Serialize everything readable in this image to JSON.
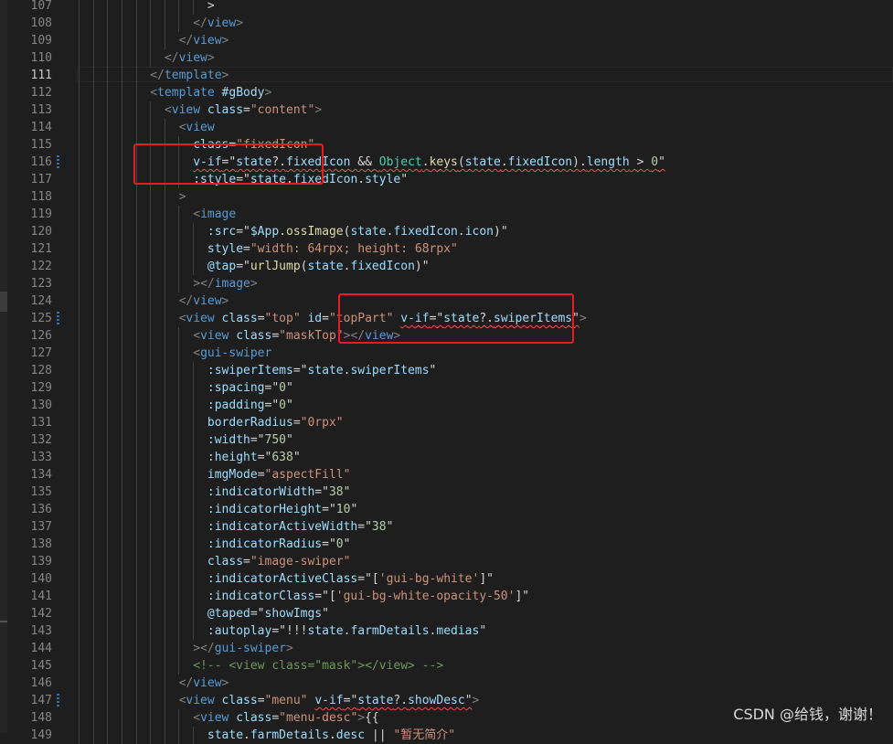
{
  "editor": {
    "active_line": 111,
    "lines": [
      {
        "n": 107,
        "t": [
          [
            "t-tk",
            "                  >"
          ]
        ]
      },
      {
        "n": 108,
        "t": [
          [
            "t-bk",
            "                </"
          ],
          [
            "t-tag",
            "view"
          ],
          [
            "t-bk",
            ">"
          ]
        ]
      },
      {
        "n": 109,
        "t": [
          [
            "t-bk",
            "              </"
          ],
          [
            "t-tag",
            "view"
          ],
          [
            "t-bk",
            ">"
          ]
        ]
      },
      {
        "n": 110,
        "t": [
          [
            "t-bk",
            "            </"
          ],
          [
            "t-tag",
            "view"
          ],
          [
            "t-bk",
            ">"
          ]
        ]
      },
      {
        "n": 111,
        "t": [
          [
            "t-bk",
            "          </"
          ],
          [
            "t-tag",
            "template"
          ],
          [
            "t-bk",
            ">"
          ]
        ]
      },
      {
        "n": 112,
        "t": [
          [
            "t-bk",
            "          <"
          ],
          [
            "t-tag",
            "template"
          ],
          [
            "t-op",
            " "
          ],
          [
            "t-at",
            "#gBody"
          ],
          [
            "t-bk",
            ">"
          ]
        ]
      },
      {
        "n": 113,
        "t": [
          [
            "t-bk",
            "            <"
          ],
          [
            "t-tag",
            "view"
          ],
          [
            "t-op",
            " "
          ],
          [
            "t-at",
            "class"
          ],
          [
            "t-op",
            "="
          ],
          [
            "t-st",
            "\"content\""
          ],
          [
            "t-bk",
            ">"
          ]
        ]
      },
      {
        "n": 114,
        "t": [
          [
            "t-bk",
            "              <"
          ],
          [
            "t-tag",
            "view"
          ]
        ]
      },
      {
        "n": 115,
        "t": [
          [
            "t-op",
            "                "
          ],
          [
            "t-at",
            "class"
          ],
          [
            "t-op",
            "="
          ],
          [
            "t-st",
            "\"fixedIcon\""
          ]
        ]
      },
      {
        "n": 116,
        "git": true,
        "t": [
          [
            "t-op",
            "                "
          ],
          [
            "t-at sq",
            "v-if"
          ],
          [
            "t-op sq",
            "=\""
          ],
          [
            "t-ex sq",
            "state"
          ],
          [
            "t-op sq",
            "?."
          ],
          [
            "t-ex sq",
            "fixedIcon"
          ],
          [
            "t-op sq",
            " && "
          ],
          [
            "t-cl sq",
            "Object"
          ],
          [
            "t-op sq",
            "."
          ],
          [
            "t-fn sq",
            "keys"
          ],
          [
            "t-op sq",
            "("
          ],
          [
            "t-ex sq",
            "state"
          ],
          [
            "t-op sq",
            "."
          ],
          [
            "t-ex sq",
            "fixedIcon"
          ],
          [
            "t-op sq",
            ")."
          ],
          [
            "t-ex sq",
            "length"
          ],
          [
            "t-op sq",
            " > "
          ],
          [
            "t-nm sq",
            "0"
          ],
          [
            "t-op sq",
            "\""
          ]
        ]
      },
      {
        "n": 117,
        "t": [
          [
            "t-op",
            "                "
          ],
          [
            "t-at",
            ":style"
          ],
          [
            "t-op",
            "=\""
          ],
          [
            "t-ex",
            "state"
          ],
          [
            "t-op",
            "."
          ],
          [
            "t-ex",
            "fixedIcon"
          ],
          [
            "t-op",
            "."
          ],
          [
            "t-ex",
            "style"
          ],
          [
            "t-op",
            "\""
          ]
        ]
      },
      {
        "n": 118,
        "t": [
          [
            "t-bk",
            "              >"
          ]
        ]
      },
      {
        "n": 119,
        "t": [
          [
            "t-bk",
            "                <"
          ],
          [
            "t-tag",
            "image"
          ]
        ]
      },
      {
        "n": 120,
        "t": [
          [
            "t-op",
            "                  "
          ],
          [
            "t-at",
            ":src"
          ],
          [
            "t-op",
            "=\""
          ],
          [
            "t-ex",
            "$App"
          ],
          [
            "t-op",
            "."
          ],
          [
            "t-fn",
            "ossImage"
          ],
          [
            "t-op",
            "("
          ],
          [
            "t-ex",
            "state"
          ],
          [
            "t-op",
            "."
          ],
          [
            "t-ex",
            "fixedIcon"
          ],
          [
            "t-op",
            "."
          ],
          [
            "t-ex",
            "icon"
          ],
          [
            "t-op",
            ")\""
          ]
        ]
      },
      {
        "n": 121,
        "t": [
          [
            "t-op",
            "                  "
          ],
          [
            "t-at",
            "style"
          ],
          [
            "t-op",
            "="
          ],
          [
            "t-st",
            "\"width: 64rpx; height: 68rpx\""
          ]
        ]
      },
      {
        "n": 122,
        "t": [
          [
            "t-op",
            "                  "
          ],
          [
            "t-at",
            "@tap"
          ],
          [
            "t-op",
            "=\""
          ],
          [
            "t-fn",
            "urlJump"
          ],
          [
            "t-op",
            "("
          ],
          [
            "t-ex",
            "state"
          ],
          [
            "t-op",
            "."
          ],
          [
            "t-ex",
            "fixedIcon"
          ],
          [
            "t-op",
            ")\""
          ]
        ]
      },
      {
        "n": 123,
        "t": [
          [
            "t-bk",
            "                ></"
          ],
          [
            "t-tag",
            "image"
          ],
          [
            "t-bk",
            ">"
          ]
        ]
      },
      {
        "n": 124,
        "t": [
          [
            "t-bk",
            "              </"
          ],
          [
            "t-tag",
            "view"
          ],
          [
            "t-bk",
            ">"
          ]
        ]
      },
      {
        "n": 125,
        "git": true,
        "t": [
          [
            "t-bk",
            "              <"
          ],
          [
            "t-tag",
            "view"
          ],
          [
            "t-op",
            " "
          ],
          [
            "t-at",
            "class"
          ],
          [
            "t-op",
            "="
          ],
          [
            "t-st",
            "\"top\""
          ],
          [
            "t-op",
            " "
          ],
          [
            "t-at",
            "id"
          ],
          [
            "t-op",
            "="
          ],
          [
            "t-st",
            "\"topPart\""
          ],
          [
            "t-op",
            " "
          ],
          [
            "t-at sq",
            "v-if"
          ],
          [
            "t-op sq",
            "=\""
          ],
          [
            "t-ex sq",
            "state"
          ],
          [
            "t-op sq",
            "?."
          ],
          [
            "t-ex sq",
            "swiperItems"
          ],
          [
            "t-op sq",
            "\""
          ],
          [
            "t-bk",
            ">"
          ]
        ]
      },
      {
        "n": 126,
        "t": [
          [
            "t-bk",
            "                <"
          ],
          [
            "t-tag",
            "view"
          ],
          [
            "t-op",
            " "
          ],
          [
            "t-at",
            "class"
          ],
          [
            "t-op",
            "="
          ],
          [
            "t-st",
            "\"maskTop\""
          ],
          [
            "t-bk",
            "></"
          ],
          [
            "t-tag",
            "view"
          ],
          [
            "t-bk",
            ">"
          ]
        ]
      },
      {
        "n": 127,
        "t": [
          [
            "t-bk",
            "                <"
          ],
          [
            "t-tag",
            "gui-swiper"
          ]
        ]
      },
      {
        "n": 128,
        "t": [
          [
            "t-op",
            "                  "
          ],
          [
            "t-at",
            ":swiperItems"
          ],
          [
            "t-op",
            "=\""
          ],
          [
            "t-ex",
            "state"
          ],
          [
            "t-op",
            "."
          ],
          [
            "t-ex",
            "swiperItems"
          ],
          [
            "t-op",
            "\""
          ]
        ]
      },
      {
        "n": 129,
        "t": [
          [
            "t-op",
            "                  "
          ],
          [
            "t-at",
            ":spacing"
          ],
          [
            "t-op",
            "=\""
          ],
          [
            "t-nm",
            "0"
          ],
          [
            "t-op",
            "\""
          ]
        ]
      },
      {
        "n": 130,
        "t": [
          [
            "t-op",
            "                  "
          ],
          [
            "t-at",
            ":padding"
          ],
          [
            "t-op",
            "=\""
          ],
          [
            "t-nm",
            "0"
          ],
          [
            "t-op",
            "\""
          ]
        ]
      },
      {
        "n": 131,
        "t": [
          [
            "t-op",
            "                  "
          ],
          [
            "t-at",
            "borderRadius"
          ],
          [
            "t-op",
            "="
          ],
          [
            "t-st",
            "\"0rpx\""
          ]
        ]
      },
      {
        "n": 132,
        "t": [
          [
            "t-op",
            "                  "
          ],
          [
            "t-at",
            ":width"
          ],
          [
            "t-op",
            "=\""
          ],
          [
            "t-nm",
            "750"
          ],
          [
            "t-op",
            "\""
          ]
        ]
      },
      {
        "n": 133,
        "t": [
          [
            "t-op",
            "                  "
          ],
          [
            "t-at",
            ":height"
          ],
          [
            "t-op",
            "=\""
          ],
          [
            "t-nm",
            "638"
          ],
          [
            "t-op",
            "\""
          ]
        ]
      },
      {
        "n": 134,
        "t": [
          [
            "t-op",
            "                  "
          ],
          [
            "t-at",
            "imgMode"
          ],
          [
            "t-op",
            "="
          ],
          [
            "t-st",
            "\"aspectFill\""
          ]
        ]
      },
      {
        "n": 135,
        "t": [
          [
            "t-op",
            "                  "
          ],
          [
            "t-at",
            ":indicatorWidth"
          ],
          [
            "t-op",
            "=\""
          ],
          [
            "t-nm",
            "38"
          ],
          [
            "t-op",
            "\""
          ]
        ]
      },
      {
        "n": 136,
        "t": [
          [
            "t-op",
            "                  "
          ],
          [
            "t-at",
            ":indicatorHeight"
          ],
          [
            "t-op",
            "=\""
          ],
          [
            "t-nm",
            "10"
          ],
          [
            "t-op",
            "\""
          ]
        ]
      },
      {
        "n": 137,
        "t": [
          [
            "t-op",
            "                  "
          ],
          [
            "t-at",
            ":indicatorActiveWidth"
          ],
          [
            "t-op",
            "=\""
          ],
          [
            "t-nm",
            "38"
          ],
          [
            "t-op",
            "\""
          ]
        ]
      },
      {
        "n": 138,
        "t": [
          [
            "t-op",
            "                  "
          ],
          [
            "t-at",
            ":indicatorRadius"
          ],
          [
            "t-op",
            "=\""
          ],
          [
            "t-nm",
            "0"
          ],
          [
            "t-op",
            "\""
          ]
        ]
      },
      {
        "n": 139,
        "t": [
          [
            "t-op",
            "                  "
          ],
          [
            "t-at",
            "class"
          ],
          [
            "t-op",
            "="
          ],
          [
            "t-st",
            "\"image-swiper\""
          ]
        ]
      },
      {
        "n": 140,
        "t": [
          [
            "t-op",
            "                  "
          ],
          [
            "t-at",
            ":indicatorActiveClass"
          ],
          [
            "t-op",
            "=\"["
          ],
          [
            "t-st",
            "'gui-bg-white'"
          ],
          [
            "t-op",
            "]\""
          ]
        ]
      },
      {
        "n": 141,
        "t": [
          [
            "t-op",
            "                  "
          ],
          [
            "t-at",
            ":indicatorClass"
          ],
          [
            "t-op",
            "=\"["
          ],
          [
            "t-st",
            "'gui-bg-white-opacity-50'"
          ],
          [
            "t-op",
            "]\""
          ]
        ]
      },
      {
        "n": 142,
        "t": [
          [
            "t-op",
            "                  "
          ],
          [
            "t-at",
            "@taped"
          ],
          [
            "t-op",
            "=\""
          ],
          [
            "t-ex",
            "showImgs"
          ],
          [
            "t-op",
            "\""
          ]
        ]
      },
      {
        "n": 143,
        "t": [
          [
            "t-op",
            "                  "
          ],
          [
            "t-at",
            ":autoplay"
          ],
          [
            "t-op",
            "=\"!!!"
          ],
          [
            "t-ex",
            "state"
          ],
          [
            "t-op",
            "."
          ],
          [
            "t-ex",
            "farmDetails"
          ],
          [
            "t-op",
            "."
          ],
          [
            "t-ex",
            "medias"
          ],
          [
            "t-op",
            "\""
          ]
        ]
      },
      {
        "n": 144,
        "t": [
          [
            "t-bk",
            "                ></"
          ],
          [
            "t-tag",
            "gui-swiper"
          ],
          [
            "t-bk",
            ">"
          ]
        ]
      },
      {
        "n": 145,
        "t": [
          [
            "t-cm",
            "                <!-- <view class=\"mask\"></view> -->"
          ]
        ]
      },
      {
        "n": 146,
        "t": [
          [
            "t-bk",
            "              </"
          ],
          [
            "t-tag",
            "view"
          ],
          [
            "t-bk",
            ">"
          ]
        ]
      },
      {
        "n": 147,
        "git": true,
        "t": [
          [
            "t-bk",
            "              <"
          ],
          [
            "t-tag",
            "view"
          ],
          [
            "t-op",
            " "
          ],
          [
            "t-at",
            "class"
          ],
          [
            "t-op",
            "="
          ],
          [
            "t-st",
            "\"menu\""
          ],
          [
            "t-op",
            " "
          ],
          [
            "t-at sq",
            "v-if"
          ],
          [
            "t-op sq",
            "=\""
          ],
          [
            "t-ex sq",
            "state"
          ],
          [
            "t-op sq",
            "?."
          ],
          [
            "t-ex sq",
            "showDesc"
          ],
          [
            "t-op sq",
            "\""
          ],
          [
            "t-bk",
            ">"
          ]
        ]
      },
      {
        "n": 148,
        "t": [
          [
            "t-bk",
            "                <"
          ],
          [
            "t-tag",
            "view"
          ],
          [
            "t-op",
            " "
          ],
          [
            "t-at",
            "class"
          ],
          [
            "t-op",
            "="
          ],
          [
            "t-st",
            "\"menu-desc\""
          ],
          [
            "t-bk",
            ">"
          ],
          [
            "t-op",
            "{{"
          ]
        ]
      },
      {
        "n": 149,
        "t": [
          [
            "t-op",
            "                  "
          ],
          [
            "t-ex",
            "state"
          ],
          [
            "t-op",
            "."
          ],
          [
            "t-ex",
            "farmDetails"
          ],
          [
            "t-op",
            "."
          ],
          [
            "t-ex",
            "desc"
          ],
          [
            "t-op",
            " || "
          ],
          [
            "t-st",
            "\"暂无简介\""
          ]
        ]
      }
    ]
  },
  "watermark": "CSDN @给钱，谢谢！"
}
